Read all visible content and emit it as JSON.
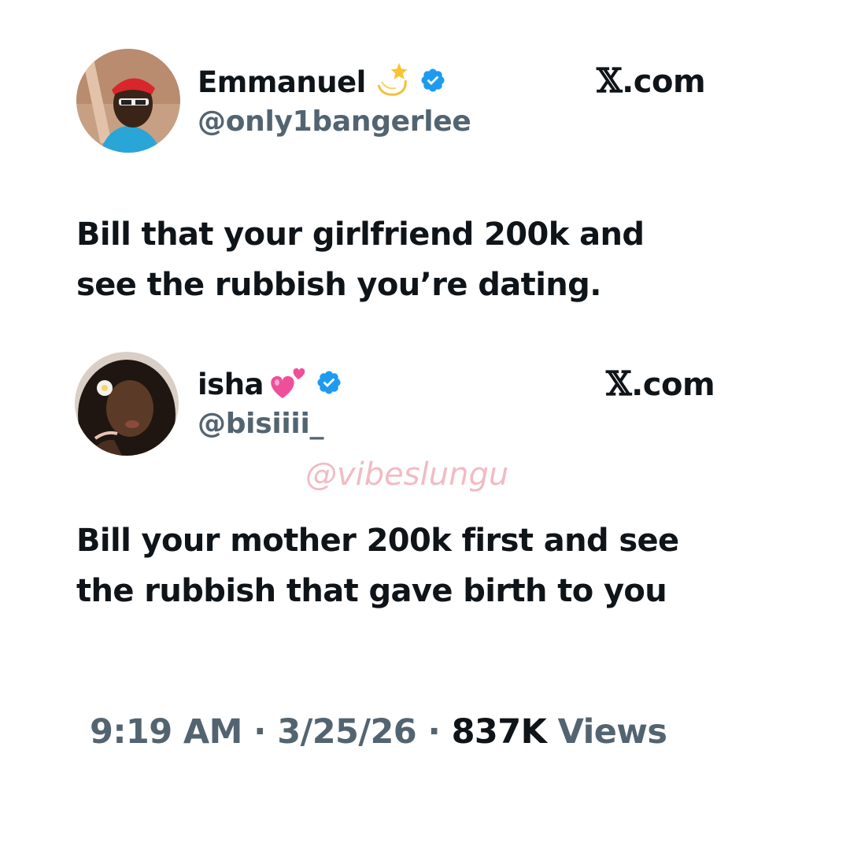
{
  "tweets": [
    {
      "display_name": "Emmanuel",
      "emoji": "dizzy-emoji",
      "handle": "@only1bangerlee",
      "site": ".com",
      "site_mark": "𝕏",
      "text_lines": [
        "Bill that your girlfriend 200k and",
        "see the rubbish you’re dating."
      ]
    },
    {
      "display_name": "isha",
      "emoji": "two-hearts-emoji",
      "handle": "@bisiiii_",
      "site": ".com",
      "site_mark": "𝕏",
      "text_lines": [
        "Bill your mother 200k first and see",
        "the rubbish that gave birth to you"
      ]
    }
  ],
  "watermark": "@vibeslungu",
  "meta": {
    "time": "9:19 AM",
    "separator": "·",
    "date": "3/25/26",
    "views_count": "837K",
    "views_label": "Views"
  },
  "colors": {
    "verified_blue": "#1d9bf0",
    "handle_gray": "#536471",
    "watermark_pink": "#f0bcc3"
  }
}
